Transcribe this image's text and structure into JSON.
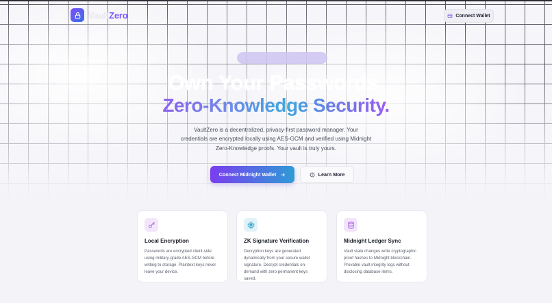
{
  "app": {
    "logo_text_prefix": "Vault",
    "logo_text_suffix": "Zero",
    "brand_color": "#7a5af5"
  },
  "nav": {
    "connect_wallet_label": "Connect Wallet"
  },
  "hero": {
    "badge_text": "",
    "title_line1": "Own Your Passwords.",
    "title_line2": "Zero-Knowledge Security.",
    "description": "VaultZero is a decentralized, privacy-first password manager. Your credentials are encrypted locally using AES-GCM and verified using Midnight Zero-Knowledge proofs. Your vault is truly yours.",
    "primary_button_label": "Connect Midnight Wallet",
    "secondary_button_label": "Learn More"
  },
  "features": [
    {
      "icon": "key-icon",
      "title": "Local Encryption",
      "text": "Passwords are encrypted client-side using military-grade AES-GCM before writing to storage. Plaintext keys never leave your device.",
      "accent": "#a763e8"
    },
    {
      "icon": "chip-icon",
      "title": "ZK Signature Verification",
      "text": "Decryption keys are generated dynamically from your secure wallet signature. Decrypt credentials on-demand with zero permanent keys saved.",
      "accent": "#2a9fc9"
    },
    {
      "icon": "database-icon",
      "title": "Midnight Ledger Sync",
      "text": "Vault state changes write cryptographic proof hashes to Midnight blockchain. Provable vault integrity logs without disclosing database items.",
      "accent": "#a85ae0"
    }
  ]
}
